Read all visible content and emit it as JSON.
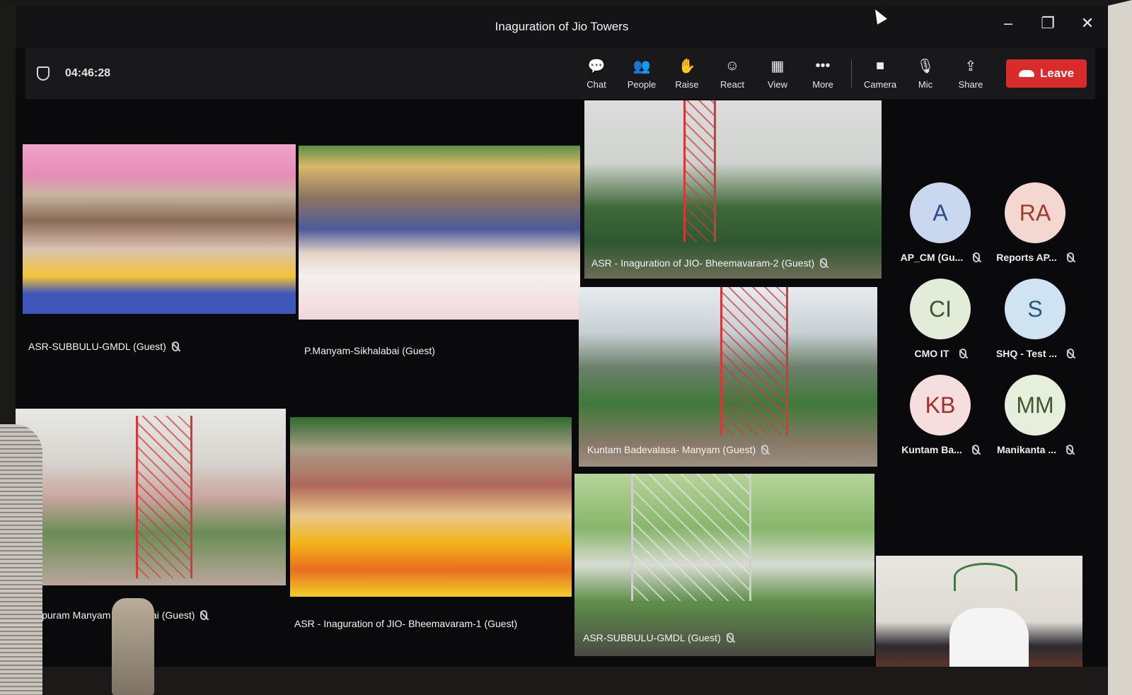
{
  "window": {
    "title": "Inaguration of Jio Towers",
    "controls": [
      "–",
      "❐",
      "✕"
    ]
  },
  "toolbar": {
    "timer": "04:46:28",
    "items": [
      {
        "label": "Chat",
        "icon": "chat-icon",
        "glyph": "💬"
      },
      {
        "label": "People",
        "icon": "people-icon",
        "glyph": "👥"
      },
      {
        "label": "Raise",
        "icon": "raise-hand-icon",
        "glyph": "✋"
      },
      {
        "label": "React",
        "icon": "react-icon",
        "glyph": "☺"
      },
      {
        "label": "View",
        "icon": "view-icon",
        "glyph": "▦"
      },
      {
        "label": "More",
        "icon": "more-icon",
        "glyph": "•••"
      }
    ],
    "media": [
      {
        "label": "Camera",
        "icon": "camera-icon",
        "glyph": "■"
      },
      {
        "label": "Mic",
        "icon": "mic-icon",
        "glyph": "🎙"
      },
      {
        "label": "Share",
        "icon": "share-icon",
        "glyph": "⇪"
      }
    ],
    "leave_label": "Leave"
  },
  "video_tiles": [
    {
      "label": "ASR-SUBBULU-GMDL (Guest)"
    },
    {
      "label": "P.Manyam-Sikhalabai (Guest)"
    },
    {
      "label": "ipuram Manyam Sikhalabai (Guest)"
    },
    {
      "label": "ASR - Inaguration of JIO- Bheemavaram-1 (Guest)"
    },
    {
      "label": "ASR - Inaguration of JIO- Bheemavaram-2 (Guest)"
    },
    {
      "label": "Kuntam Badevalasa- Manyam (Guest)"
    },
    {
      "label": "ASR-SUBBULU-GMDL (Guest)"
    }
  ],
  "participants": [
    {
      "initials": "A",
      "name": "AP_CM (Gu...",
      "bg": "#c9d8ef",
      "fg": "#2a4a8a"
    },
    {
      "initials": "RA",
      "name": "Reports AP...",
      "bg": "#f5d7d2",
      "fg": "#a23a2a"
    },
    {
      "initials": "CI",
      "name": "CMO IT",
      "bg": "#e2ecd9",
      "fg": "#3a5a2a"
    },
    {
      "initials": "S",
      "name": "SHQ - Test ...",
      "bg": "#cfe3f2",
      "fg": "#2a5a7a"
    },
    {
      "initials": "KB",
      "name": "Kuntam Ba...",
      "bg": "#f7dede",
      "fg": "#a0302a"
    },
    {
      "initials": "MM",
      "name": "Manikanta ...",
      "bg": "#e6eedc",
      "fg": "#3e5a2e"
    }
  ],
  "colors": {
    "leave": "#d92b2b",
    "toolbar": "#19191b",
    "stage": "#0a0a0c"
  }
}
